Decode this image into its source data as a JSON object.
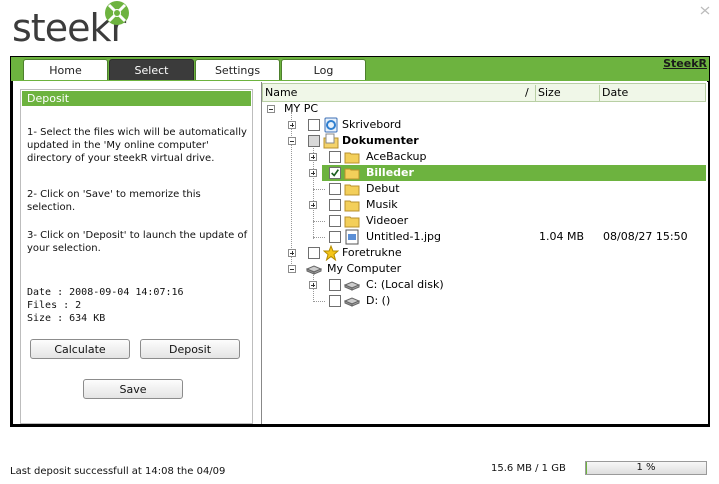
{
  "app": {
    "logo_text": "steekr",
    "brand_color": "#6db33f"
  },
  "tabs": [
    {
      "label": "Home",
      "active": false
    },
    {
      "label": "Select",
      "active": true
    },
    {
      "label": "Settings",
      "active": false
    },
    {
      "label": "Log",
      "active": false
    }
  ],
  "header_link": "SteekR",
  "deposit_panel": {
    "title": "Deposit",
    "steps": [
      "1- Select the files wich will be automatically updated in the 'My online computer' directory of your steekR virtual drive.",
      "2- Click on 'Save' to memorize this selection.",
      "3- Click on 'Deposit' to launch the update of your selection."
    ],
    "info": {
      "date": "Date : 2008-09-04 14:07:16",
      "files": "Files : 2",
      "size": "Size : 634 KB"
    },
    "buttons": {
      "calculate": "Calculate",
      "deposit": "Deposit",
      "save": "Save"
    }
  },
  "tree": {
    "columns": {
      "name": "Name",
      "size": "Size",
      "date": "Date"
    },
    "sort_indicator": "/",
    "rows": [
      {
        "label": "MY PC",
        "size": "",
        "date": "",
        "icon": "none"
      },
      {
        "label": "Skrivebord",
        "size": "",
        "date": "",
        "icon": "desktop-icon"
      },
      {
        "label": "Dokumenter",
        "size": "",
        "date": "",
        "icon": "documents-icon"
      },
      {
        "label": "AceBackup",
        "size": "",
        "date": "",
        "icon": "folder-icon"
      },
      {
        "label": "Billeder",
        "size": "",
        "date": "",
        "icon": "folder-icon"
      },
      {
        "label": "Debut",
        "size": "",
        "date": "",
        "icon": "folder-icon"
      },
      {
        "label": "Musik",
        "size": "",
        "date": "",
        "icon": "folder-icon"
      },
      {
        "label": "Videoer",
        "size": "",
        "date": "",
        "icon": "folder-icon"
      },
      {
        "label": "Untitled-1.jpg",
        "size": "1.04 MB",
        "date": "08/08/27 15:50",
        "icon": "image-file-icon"
      },
      {
        "label": "Foretrukne",
        "size": "",
        "date": "",
        "icon": "star-icon"
      },
      {
        "label": "My Computer",
        "size": "",
        "date": "",
        "icon": "computer-icon"
      },
      {
        "label": "C: (Local disk)",
        "size": "",
        "date": "",
        "icon": "drive-icon"
      },
      {
        "label": "D: ()",
        "size": "",
        "date": "",
        "icon": "drive-icon"
      }
    ]
  },
  "status": {
    "message": "Last deposit successfull at 14:08 the 04/09",
    "usage": "15.6 MB / 1 GB",
    "progress_label": "1 %",
    "progress_value": 0.01
  }
}
